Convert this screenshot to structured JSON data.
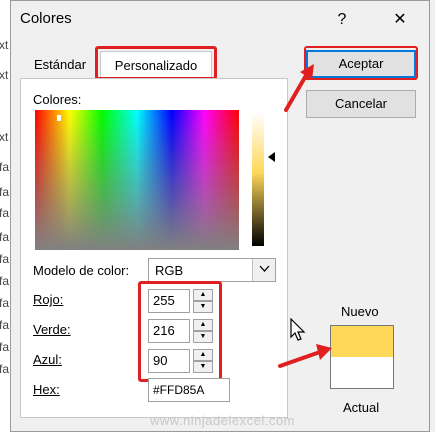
{
  "background": {
    "labels": [
      "xt",
      "xt",
      "xt",
      "fa",
      "fa",
      "fa",
      "fa",
      "fa",
      "fa",
      "fa",
      "fa",
      "fa",
      "fa"
    ]
  },
  "dialog": {
    "title": "Colores",
    "help_glyph": "?",
    "close_glyph": "✕"
  },
  "tabs": [
    {
      "label": "Estándar"
    },
    {
      "label": "Personalizado"
    }
  ],
  "custom": {
    "colors_label": "Colores:",
    "color_model_label": "Modelo de color:",
    "color_model_value": "RGB",
    "red_label": "Rojo:",
    "red_value": "255",
    "green_label": "Verde:",
    "green_value": "216",
    "blue_label": "Azul:",
    "blue_value": "90",
    "hex_label": "Hex:",
    "hex_value": "#FFD85A"
  },
  "buttons": {
    "ok": "Aceptar",
    "cancel": "Cancelar"
  },
  "preview": {
    "new_label": "Nuevo",
    "current_label": "Actual",
    "new_color": "#FFD85A",
    "current_color": "#FFFFFF"
  },
  "watermark": "www.ninjadelexcel.com",
  "icons": {
    "dropdown": "chevron-down-icon",
    "spin_up": "spin-up-icon",
    "spin_down": "spin-down-icon"
  },
  "colors": {
    "accent": "#0078d7",
    "annotation": "#e02020"
  }
}
